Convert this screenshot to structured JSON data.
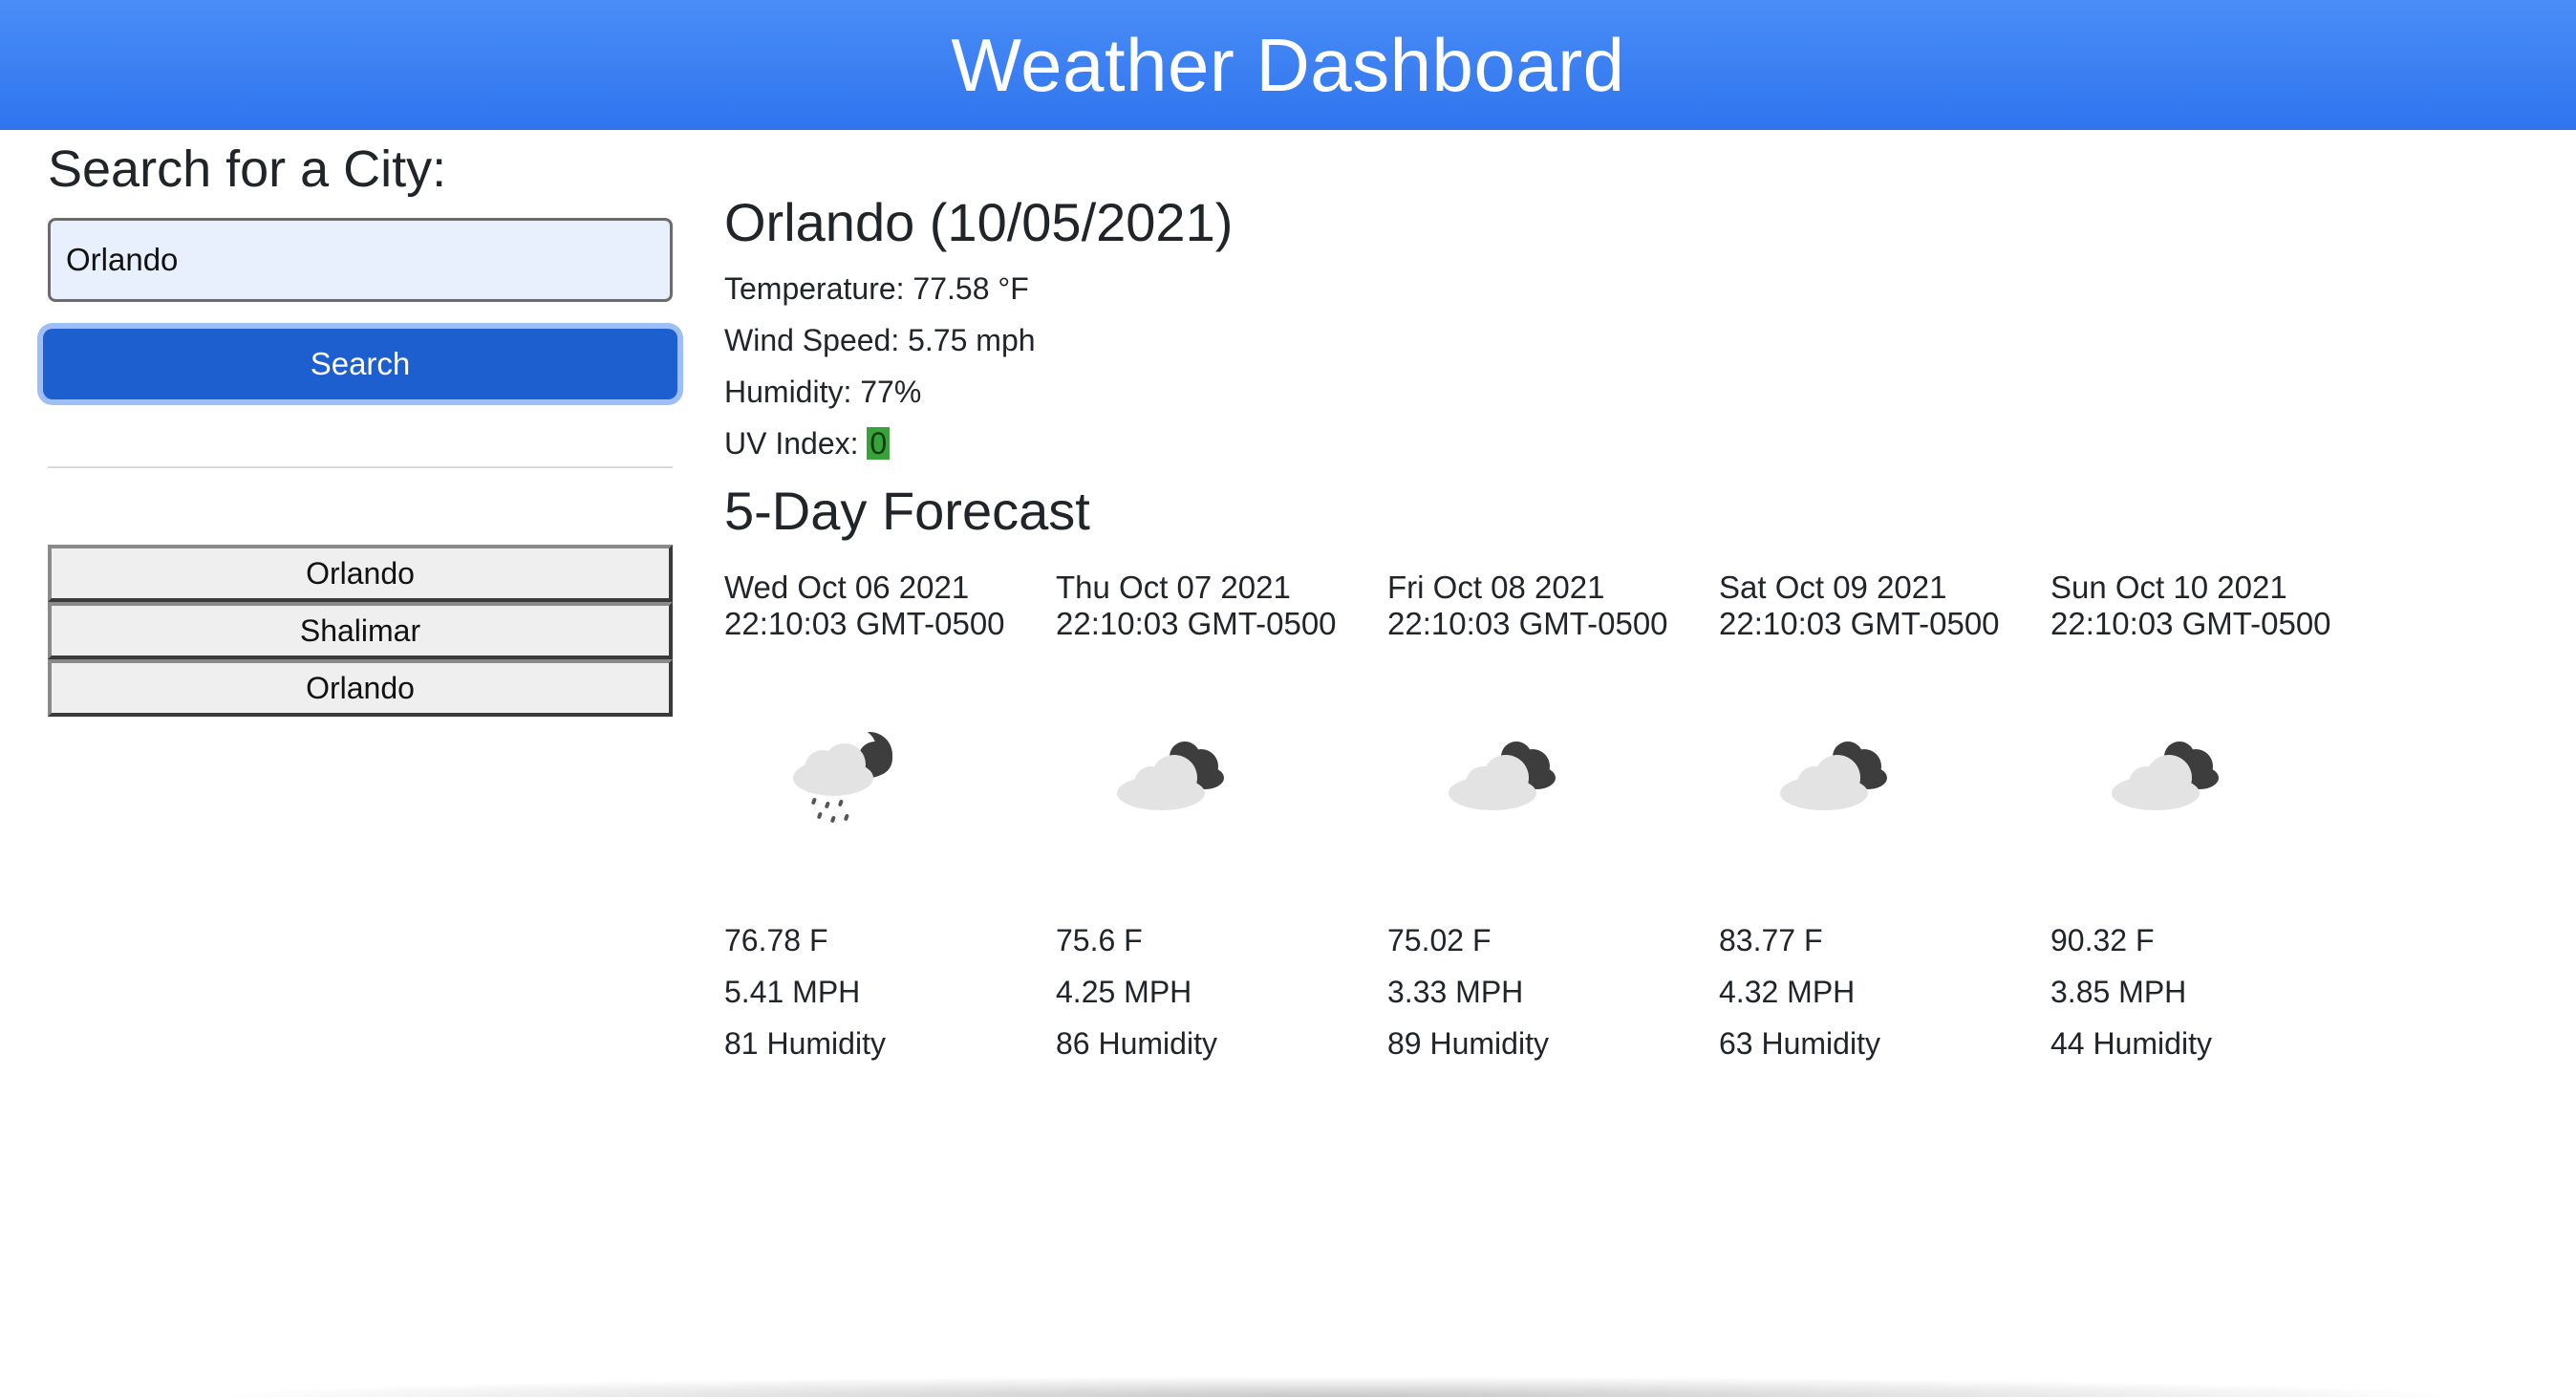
{
  "header": {
    "title": "Weather Dashboard"
  },
  "search": {
    "heading": "Search for a City:",
    "input_value": "Orlando",
    "button_label": "Search"
  },
  "history": [
    "Orlando",
    "Shalimar",
    "Orlando"
  ],
  "current": {
    "title": "Orlando (10/05/2021)",
    "temperature": "Temperature: 77.58 °F",
    "wind": "Wind Speed: 5.75 mph",
    "humidity": "Humidity: 77%",
    "uv_label": "UV Index: ",
    "uv_value": "0",
    "uv_color": "#3aa23a"
  },
  "forecast": {
    "title": "5-Day Forecast",
    "days": [
      {
        "date": "Wed Oct 06 2021 22:10:03 GMT-0500",
        "icon": "rain-night-icon",
        "temp": "76.78 F",
        "wind": "5.41 MPH",
        "humidity": "81 Humidity"
      },
      {
        "date": "Thu Oct 07 2021 22:10:03 GMT-0500",
        "icon": "clouds-icon",
        "temp": "75.6 F",
        "wind": "4.25 MPH",
        "humidity": "86 Humidity"
      },
      {
        "date": "Fri Oct 08 2021 22:10:03 GMT-0500",
        "icon": "clouds-icon",
        "temp": "75.02 F",
        "wind": "3.33 MPH",
        "humidity": "89 Humidity"
      },
      {
        "date": "Sat Oct 09 2021 22:10:03 GMT-0500",
        "icon": "clouds-icon",
        "temp": "83.77 F",
        "wind": "4.32 MPH",
        "humidity": "63 Humidity"
      },
      {
        "date": "Sun Oct 10 2021 22:10:03 GMT-0500",
        "icon": "clouds-icon",
        "temp": "90.32 F",
        "wind": "3.85 MPH",
        "humidity": "44 Humidity"
      }
    ]
  },
  "colors": {
    "header_bg": "#3b82f6",
    "button_bg": "#1e5fd0",
    "input_bg": "#e8f0fe"
  }
}
